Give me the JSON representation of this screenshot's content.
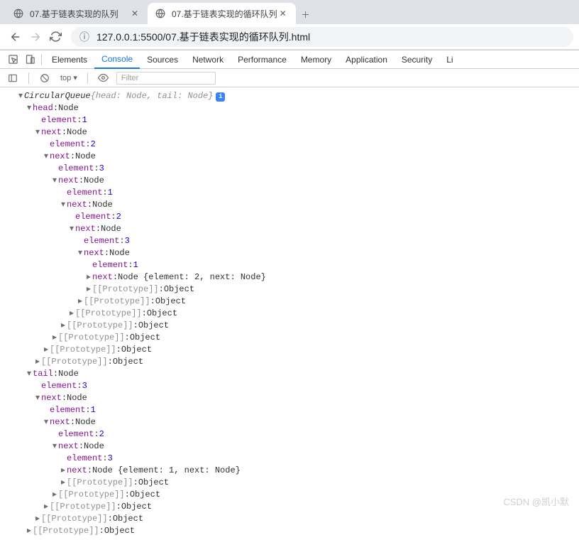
{
  "tabs": {
    "t1": "07.基于链表实现的队列",
    "t2": "07.基于链表实现的循环队列"
  },
  "url": "127.0.0.1:5500/07.基于链表实现的循环队列.html",
  "dtTabs": {
    "elements": "Elements",
    "console": "Console",
    "sources": "Sources",
    "network": "Network",
    "performance": "Performance",
    "memory": "Memory",
    "application": "Application",
    "security": "Security",
    "li": "Li"
  },
  "toolbar": {
    "top": "top ▾",
    "filter": "Filter"
  },
  "c": {
    "rootClass": "CircularQueue ",
    "rootPreview": "{head: Node, tail: Node}",
    "head": "head",
    "tail": "tail",
    "node": "Node",
    "element": "element",
    "next": "next",
    "proto": "[[Prototype]]",
    "object": "Object",
    "nextPreview2": "Node {element: 2, next: Node}",
    "nextPreview1": "Node {element: 1, next: Node}",
    "v1": "1",
    "v2": "2",
    "v3": "3"
  },
  "watermark": "CSDN @凯小默"
}
